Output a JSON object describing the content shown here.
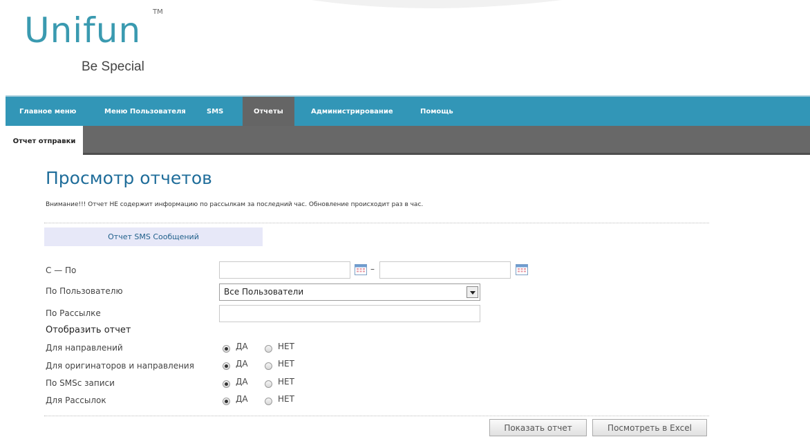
{
  "brand": {
    "name": "Unifun",
    "trademark": "TM",
    "tagline": "Be Special",
    "color": "#3a9ab0"
  },
  "nav": {
    "items": [
      "Главное меню",
      "Меню Пользователя",
      "SMS",
      "Отчеты",
      "Администрирование",
      "Помощь"
    ],
    "active": "Отчеты",
    "color": "#3296b7"
  },
  "subnav": {
    "tab": "Отчет отправки"
  },
  "page": {
    "title": "Просмотр отчетов",
    "notice": "Внимание!!! Отчет НЕ содержит информацию по рассылкам за последний час. Обновление происходит раз в час."
  },
  "form": {
    "section_title": "Отчет SMS Сообщений",
    "date_range_label": "С — По",
    "date_from": "",
    "date_to": "",
    "date_separator": "–",
    "user_label": "По Пользователю",
    "user_selected": "Все Пользователи",
    "mailing_label": "По Рассылке",
    "mailing_value": "",
    "display_heading": "Отобразить отчет",
    "options": [
      {
        "label": "Для направлений",
        "yes": "ДА",
        "no": "НЕТ",
        "selected": "yes"
      },
      {
        "label": "Для оригинаторов и направления",
        "yes": "ДА",
        "no": "НЕТ",
        "selected": "yes"
      },
      {
        "label": "По SMSc записи",
        "yes": "ДА",
        "no": "НЕТ",
        "selected": "yes"
      },
      {
        "label": "Для Рассылок",
        "yes": "ДА",
        "no": "НЕТ",
        "selected": "yes"
      }
    ]
  },
  "buttons": {
    "show_report": "Показать отчет",
    "excel": "Посмотреть в Excel"
  }
}
